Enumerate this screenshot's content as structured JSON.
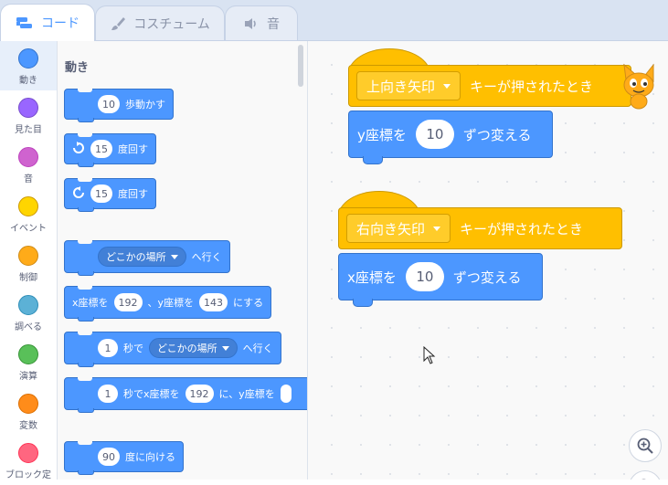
{
  "tabs": [
    {
      "label": "コード",
      "icon": "code-blocks-icon",
      "active": true
    },
    {
      "label": "コスチューム",
      "icon": "brush-icon",
      "active": false
    },
    {
      "label": "音",
      "icon": "speaker-icon",
      "active": false
    }
  ],
  "categories": [
    {
      "label": "動き",
      "color": "#4c97ff",
      "selected": true
    },
    {
      "label": "見た目",
      "color": "#9966ff"
    },
    {
      "label": "音",
      "color": "#cf63cf"
    },
    {
      "label": "イベント",
      "color": "#ffd500"
    },
    {
      "label": "制御",
      "color": "#ffab19"
    },
    {
      "label": "調べる",
      "color": "#5cb1d6"
    },
    {
      "label": "演算",
      "color": "#59c059"
    },
    {
      "label": "変数",
      "color": "#ff8c1a"
    },
    {
      "label": "ブロック定",
      "color": "#ff6680"
    }
  ],
  "palette": {
    "title": "動き",
    "move": {
      "value": "10",
      "text": "歩動かす"
    },
    "turn_right": {
      "value": "15",
      "text": "度回す"
    },
    "turn_left": {
      "value": "15",
      "text": "度回す"
    },
    "goto": {
      "dropdown": "どこかの場所",
      "text": "へ行く"
    },
    "goto_xy": {
      "x_label": "x座標を",
      "x": "192",
      "sep": "、y座標を",
      "y": "143",
      "text": "にする"
    },
    "glide": {
      "secs": "1",
      "mid": "秒で",
      "dropdown": "どこかの場所",
      "text": "へ行く"
    },
    "glide_xy": {
      "secs": "1",
      "mid": "秒でx座標を",
      "x": "192",
      "text": "に、y座標を"
    },
    "point": {
      "value": "90",
      "text": "度に向ける"
    }
  },
  "scripts": [
    {
      "hat": {
        "key": "上向き矢印",
        "text": "キーが押されたとき"
      },
      "block": {
        "label": "y座標を",
        "value": "10",
        "text": "ずつ変える"
      }
    },
    {
      "hat": {
        "key": "右向き矢印",
        "text": "キーが押されたとき"
      },
      "block": {
        "label": "x座標を",
        "value": "10",
        "text": "ずつ変える"
      }
    }
  ],
  "colors": {
    "motion": "#4c97ff",
    "events": "#ffbf00",
    "accent": "#4c97ff"
  }
}
